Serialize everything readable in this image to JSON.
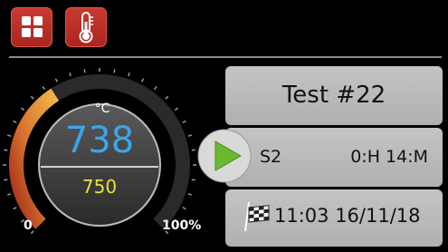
{
  "toolbar": {
    "buttons": [
      {
        "icon": "grid-icon",
        "color": "#b9302a"
      },
      {
        "icon": "thermometer-icon",
        "color": "#b9302a"
      }
    ]
  },
  "gauge": {
    "unit": "°C",
    "current": "738",
    "setpoint": "750",
    "scale_min": "0",
    "scale_max": "100%",
    "fill_fraction": 0.38,
    "current_color": "#3aa6e8",
    "setpoint_color": "#e4e23a",
    "arc_color": "#e8a23c"
  },
  "program": {
    "title": "Test #22",
    "step": "S2",
    "step_duration": "0:H 14:M",
    "end_time": "11:03 16/11/18",
    "play_color": "#6cb82f"
  }
}
